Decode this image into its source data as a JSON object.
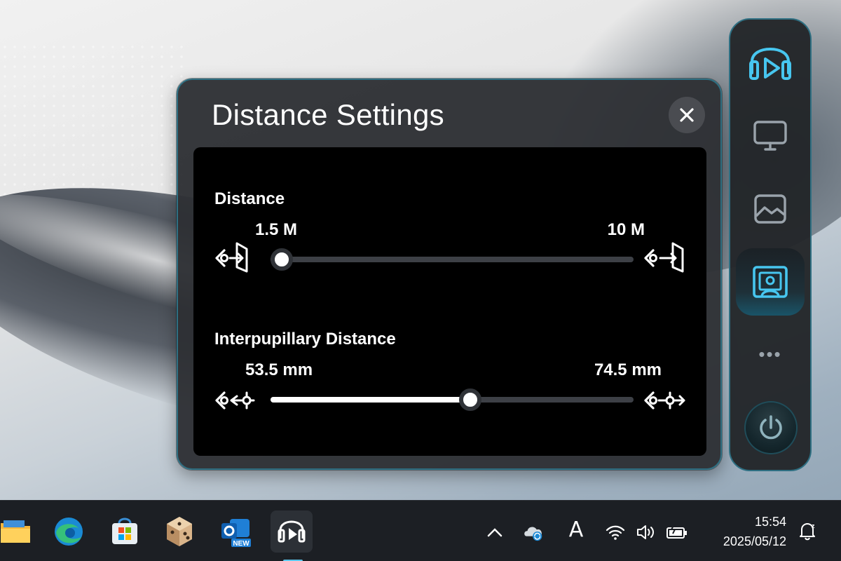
{
  "dialog": {
    "title": "Distance Settings",
    "close_icon": "close-icon"
  },
  "distance": {
    "label": "Distance",
    "min_label": "1.5 M",
    "max_label": "10 M",
    "min_icon": "view-near-icon",
    "max_icon": "view-far-icon",
    "value_fraction": 0.03
  },
  "ipd": {
    "label": "Interpupillary Distance",
    "min_label": "53.5 mm",
    "max_label": "74.5 mm",
    "min_icon": "ipd-narrow-icon",
    "max_icon": "ipd-wide-icon",
    "value_fraction": 0.55
  },
  "dock": {
    "items": [
      "vr-headset-icon",
      "monitor-icon",
      "image-icon",
      "distance-settings-icon"
    ],
    "active_item": "distance-settings-icon",
    "more_label": "•••",
    "power_icon": "power-icon"
  },
  "taskbar": {
    "apps": [
      "file-explorer-icon",
      "edge-icon",
      "microsoft-store-icon",
      "dice-app-icon",
      "outlook-new-icon",
      "xr-app-icon"
    ],
    "outlook_badge": "NEW",
    "tray": [
      "chevron-up-icon",
      "onedrive-sync-icon",
      "ime-icon",
      "wifi-icon",
      "volume-icon",
      "battery-icon"
    ],
    "ime_label": "A",
    "time": "15:54",
    "date": "2025/05/12",
    "notification_icon": "notification-bell-icon"
  },
  "colors": {
    "accent": "#47c6ef",
    "border": "#2e6f82",
    "panel": "#000000",
    "dialog_bg": "#2e3034"
  }
}
